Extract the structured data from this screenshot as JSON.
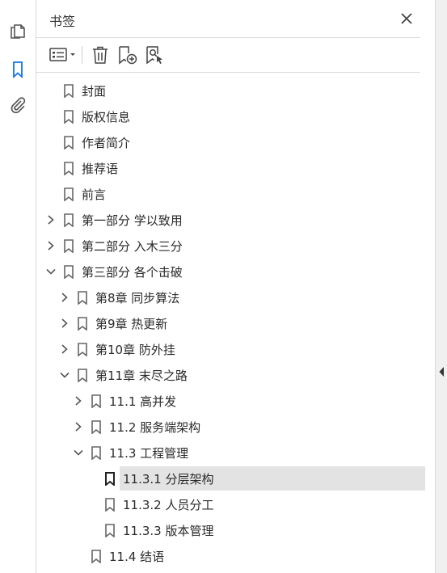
{
  "panel": {
    "title": "书签",
    "close_icon": "close-icon"
  },
  "leftbar": {
    "icons": [
      "pages-icon",
      "bookmark-icon",
      "paperclip-icon"
    ],
    "active": "bookmark-icon",
    "accent_color": "#1473e6"
  },
  "toolbar": {
    "icons": [
      "options-menu-icon",
      "chevron-down-icon",
      "trash-icon",
      "new-bookmark-icon",
      "find-bookmark-icon"
    ]
  },
  "bookmarks": [
    {
      "label": "封面",
      "level": 0,
      "state": "none"
    },
    {
      "label": "版权信息",
      "level": 0,
      "state": "none"
    },
    {
      "label": "作者简介",
      "level": 0,
      "state": "none"
    },
    {
      "label": "推荐语",
      "level": 0,
      "state": "none"
    },
    {
      "label": "前言",
      "level": 0,
      "state": "none"
    },
    {
      "label": "第一部分 学以致用",
      "level": 0,
      "state": "collapsed"
    },
    {
      "label": "第二部分 入木三分",
      "level": 0,
      "state": "collapsed"
    },
    {
      "label": "第三部分 各个击破",
      "level": 0,
      "state": "expanded"
    },
    {
      "label": "第8章 同步算法",
      "level": 1,
      "state": "collapsed"
    },
    {
      "label": "第9章 热更新",
      "level": 1,
      "state": "collapsed"
    },
    {
      "label": "第10章 防外挂",
      "level": 1,
      "state": "collapsed"
    },
    {
      "label": "第11章 末尽之路",
      "level": 1,
      "state": "expanded"
    },
    {
      "label": "11.1 高并发",
      "level": 2,
      "state": "collapsed"
    },
    {
      "label": "11.2 服务端架构",
      "level": 2,
      "state": "collapsed"
    },
    {
      "label": "11.3 工程管理",
      "level": 2,
      "state": "expanded"
    },
    {
      "label": "11.3.1 分层架构",
      "level": 3,
      "state": "none",
      "selected": true
    },
    {
      "label": "11.3.2 人员分工",
      "level": 3,
      "state": "none"
    },
    {
      "label": "11.3.3 版本管理",
      "level": 3,
      "state": "none"
    },
    {
      "label": "11.4 结语",
      "level": 2,
      "state": "none"
    }
  ],
  "rightbar": {
    "collapse_icon": "chevron-left-icon"
  }
}
